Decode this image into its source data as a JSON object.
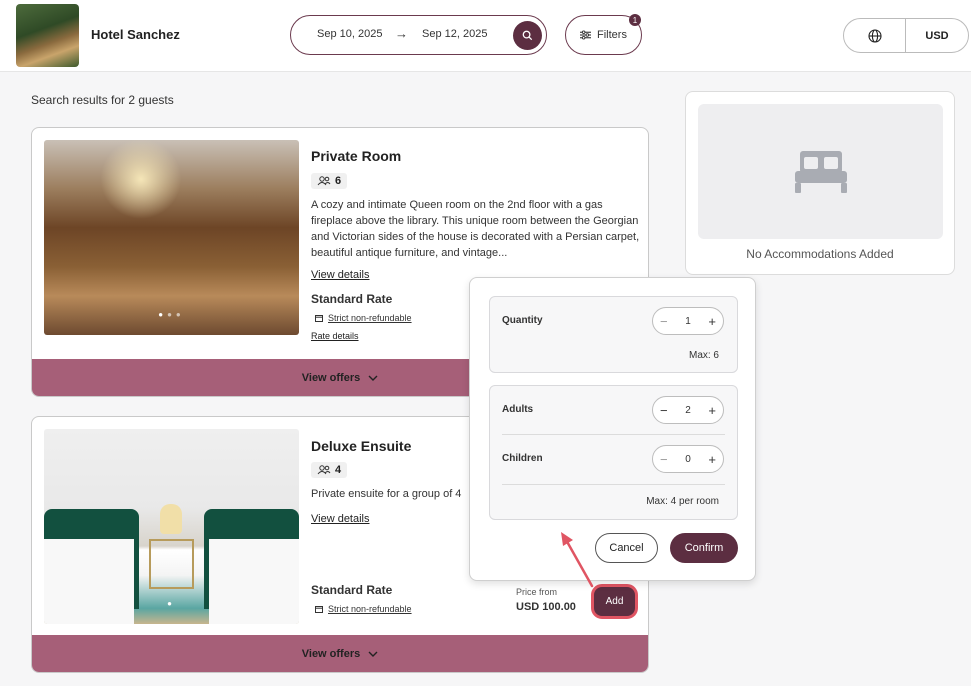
{
  "header": {
    "hotel_name": "Hotel Sanchez",
    "check_in": "Sep 10, 2025",
    "check_out": "Sep 12, 2025",
    "filters_label": "Filters",
    "filters_badge": "1",
    "currency": "USD"
  },
  "results_label": "Search results for 2 guests",
  "rooms": [
    {
      "title": "Private Room",
      "occupancy": "6",
      "description": "A cozy and intimate Queen room on the 2nd floor with a gas fireplace above the library. This unique room between the Georgian and Victorian sides of the house is decorated with a Persian carpet, beautiful antique furniture, and vintage...",
      "view_details": "View details",
      "rate_title": "Standard Rate",
      "refund_policy": "Strict non-refundable",
      "rate_details": "Rate details",
      "offers_label": "View offers"
    },
    {
      "title": "Deluxe Ensuite",
      "occupancy": "4",
      "description": "Private ensuite for a group of 4",
      "view_details": "View details",
      "rate_title": "Standard Rate",
      "refund_policy": "Strict non-refundable",
      "price_from": "Price from",
      "price": "USD 100.00",
      "add_label": "Add",
      "offers_label": "View offers"
    }
  ],
  "side_panel": {
    "empty_text": "No Accommodations Added"
  },
  "popover": {
    "quantity_label": "Quantity",
    "quantity_value": "1",
    "quantity_max": "Max: 6",
    "adults_label": "Adults",
    "adults_value": "2",
    "children_label": "Children",
    "children_value": "0",
    "guests_max": "Max: 4 per room",
    "cancel_label": "Cancel",
    "confirm_label": "Confirm"
  },
  "colors": {
    "brand": "#5c2e41",
    "offers_bar": "#a65f78",
    "highlight": "#e05563"
  },
  "icons": [
    "search-icon",
    "filters-icon",
    "globe-icon",
    "guests-icon",
    "calendar-icon",
    "chevron-down-icon",
    "bed-icon",
    "arrow-right-icon",
    "minus-icon",
    "plus-icon"
  ]
}
